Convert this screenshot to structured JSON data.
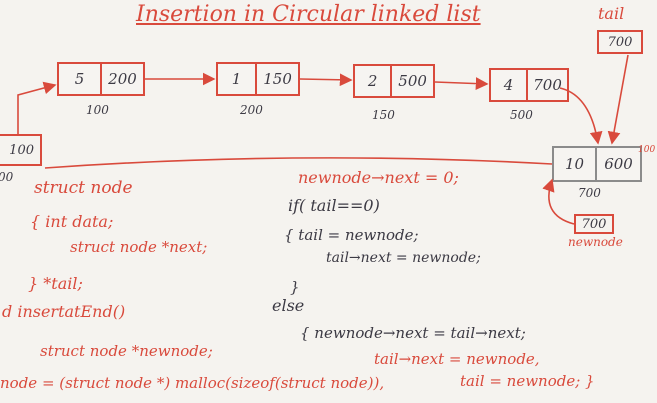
{
  "title": "Insertion in Circular linked list",
  "tail_label": "tail",
  "tail_value": "700",
  "head_value": "100",
  "head_partial_left": "00",
  "nodes": [
    {
      "data": "5",
      "next": "200",
      "address": "100"
    },
    {
      "data": "1",
      "next": "150",
      "address": "200"
    },
    {
      "data": "2",
      "next": "500",
      "address": "150"
    },
    {
      "data": "4",
      "next": "700",
      "address": "500"
    }
  ],
  "new_node": {
    "data": "10",
    "next": "600",
    "next_overwritten": "100",
    "address": "700"
  },
  "newnode_box_value": "700",
  "newnode_label": "newnode",
  "code_left": {
    "line1": "struct node",
    "line2": "{   int data;",
    "line3": "struct node *next;",
    "line4": "} *tail;",
    "line5": "d   insertatEnd()",
    "line6": "struct node *newnode;",
    "line7": "node = (struct node *) malloc(sizeof(struct node)),"
  },
  "code_right": {
    "line1": "newnode→next = 0;",
    "line2": "if( tail==0)",
    "line3": "{   tail = newnode;",
    "line4": "tail→next = newnode;",
    "line5": "}",
    "line6": "else",
    "line7": "{   newnode→next = tail→next;",
    "line8": "tail→next = newnode,",
    "line9": "tail = newnode;  }"
  }
}
